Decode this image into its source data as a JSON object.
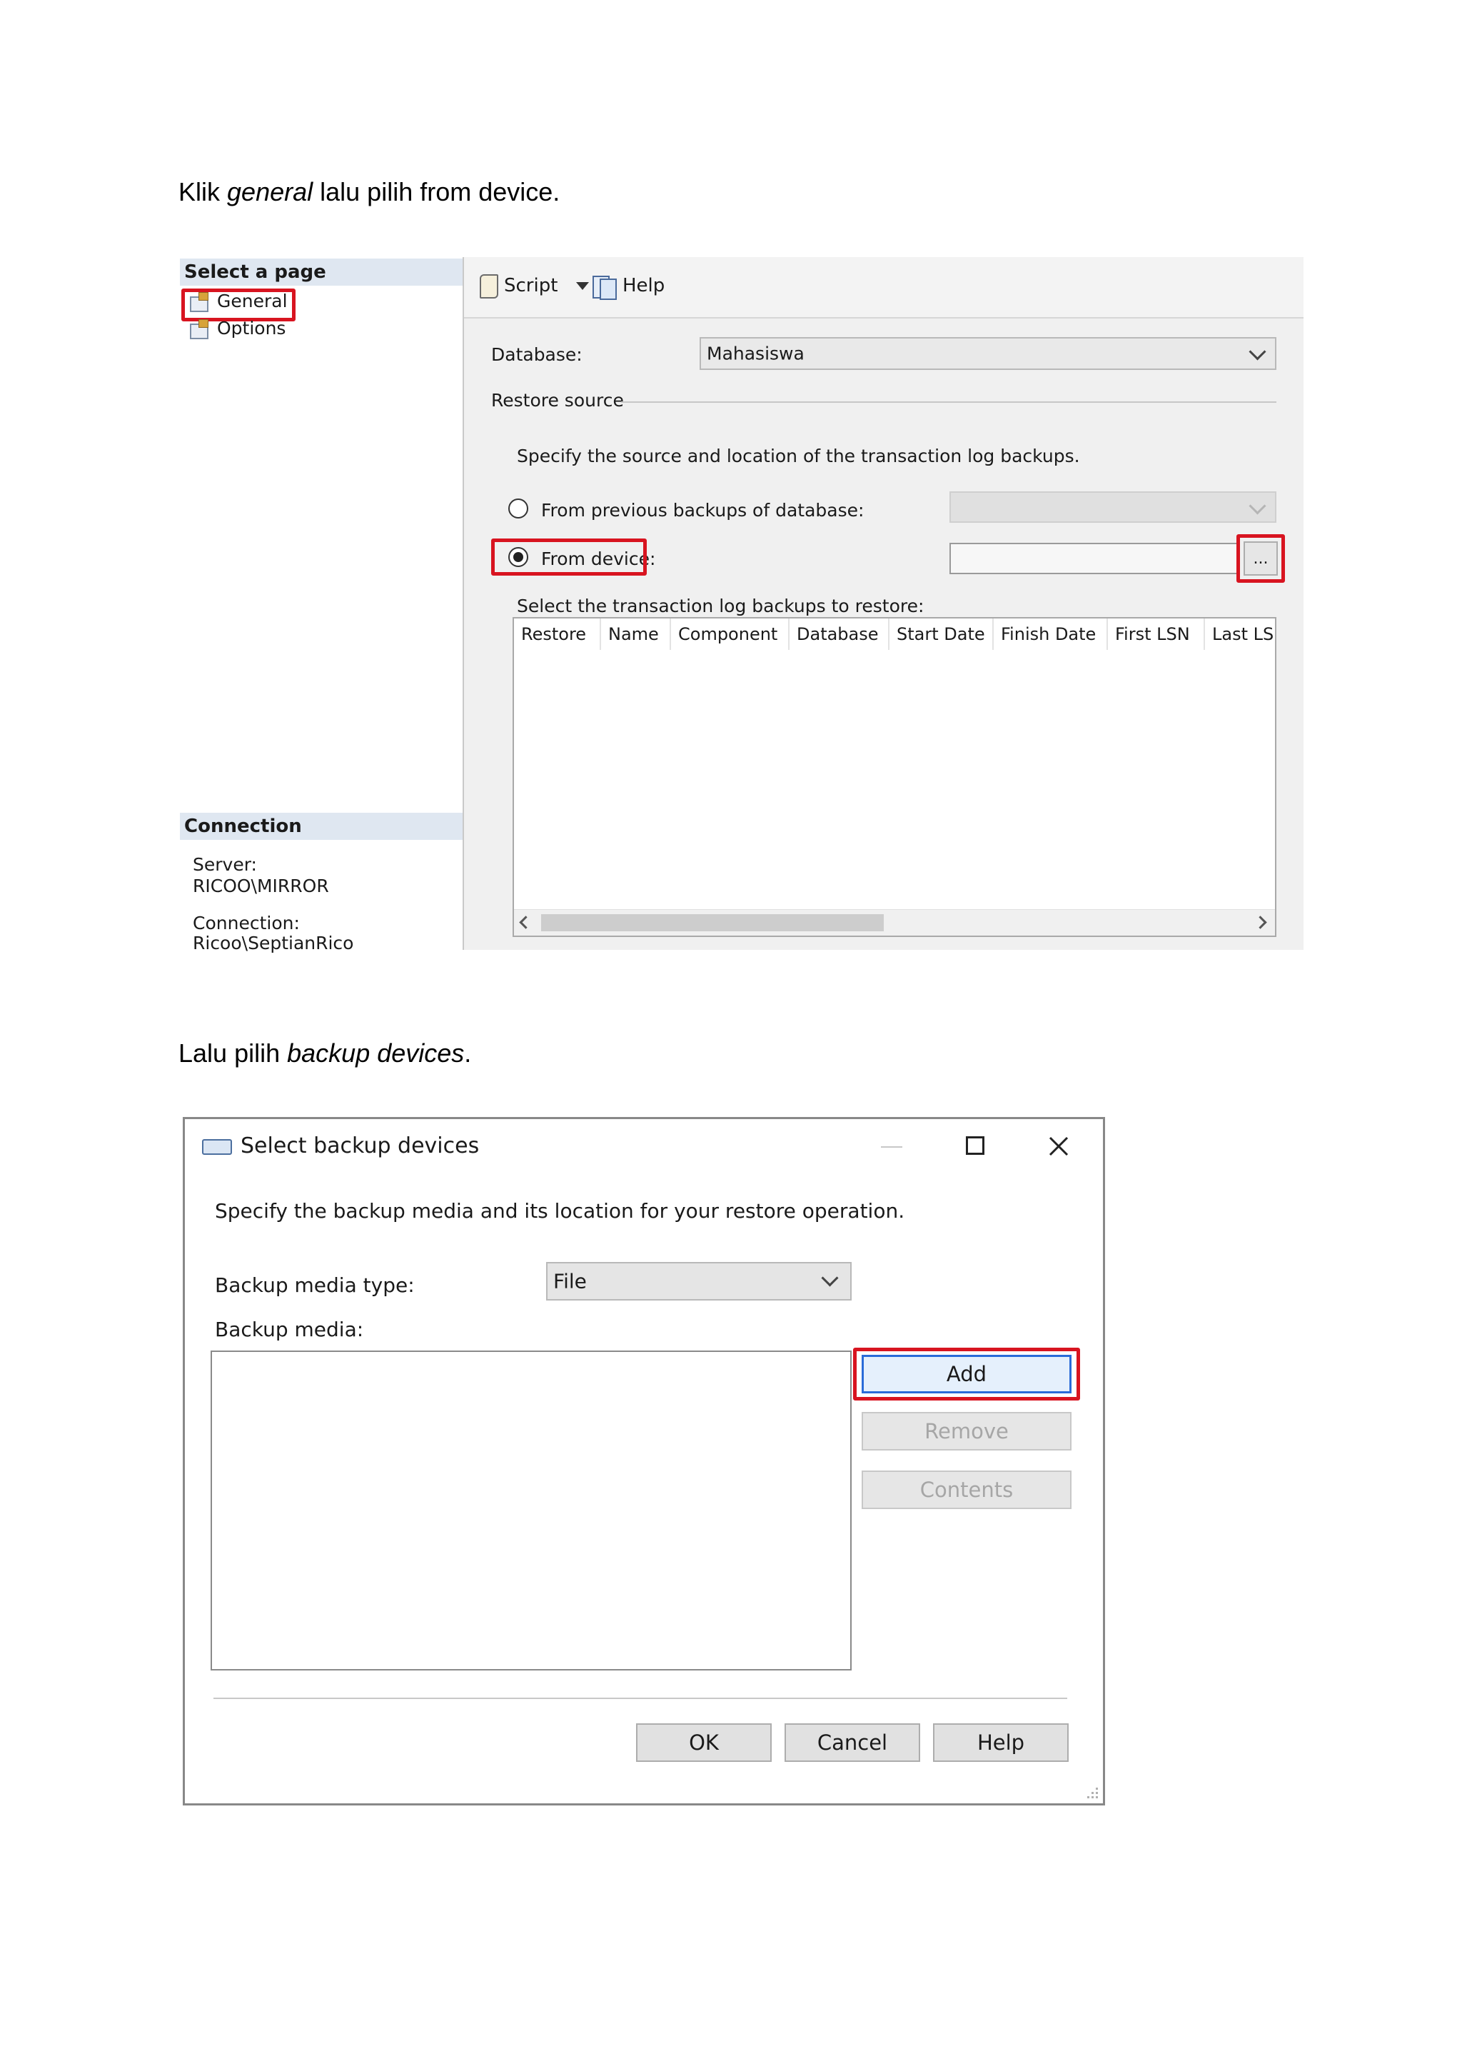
{
  "captions": {
    "step1_pre": "Klik",
    "step1_em": "general",
    "step1_post": "lalu pilih from device.",
    "step2_pre": "Lalu pilih",
    "step2_em": "backup devices",
    "step2_post": "."
  },
  "restore_dialog": {
    "select_page_header": "Select a page",
    "pages": [
      "General",
      "Options"
    ],
    "connection_header": "Connection",
    "server_label": "Server:",
    "server_value": "RICOO\\MIRROR",
    "connection_label": "Connection:",
    "connection_value": "Ricoo\\SeptianRico",
    "toolbar": {
      "script": "Script",
      "help": "Help"
    },
    "database_label": "Database:",
    "database_value": "Mahasiswa",
    "restore_source_label": "Restore source",
    "instruction": "Specify the source and location of the transaction log backups.",
    "from_previous_label": "From previous backups of database:",
    "from_device_label": "From device:",
    "browse_label": "...",
    "select_backups_label": "Select the transaction log backups to restore:",
    "columns": [
      "Restore",
      "Name",
      "Component",
      "Database",
      "Start Date",
      "Finish Date",
      "First LSN",
      "Last LSI"
    ],
    "selected_source": "From device"
  },
  "backup_devices_dialog": {
    "title": "Select backup devices",
    "instruction": "Specify the backup media and its location for your restore operation.",
    "media_type_label": "Backup media type:",
    "media_type_value": "File",
    "backup_media_label": "Backup media:",
    "buttons": {
      "add": "Add",
      "remove": "Remove",
      "contents": "Contents",
      "ok": "OK",
      "cancel": "Cancel",
      "help": "Help"
    }
  },
  "colors": {
    "highlight": "#d81420",
    "focus_border": "#2a6bd8",
    "section_header": "#dfe7f1"
  }
}
